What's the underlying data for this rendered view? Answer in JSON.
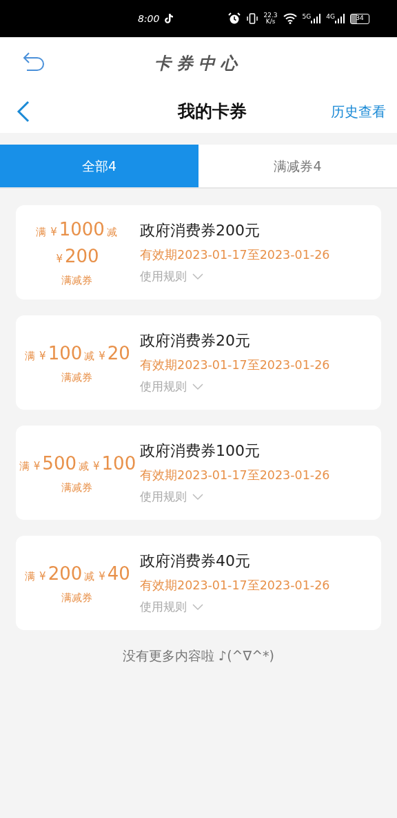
{
  "status_bar": {
    "time": "8:00",
    "speed": "22.3",
    "speed_unit": "K/s",
    "network_1": "5G",
    "network_2": "4G",
    "battery": "34"
  },
  "app_header": {
    "title": "卡券中心"
  },
  "nav": {
    "title": "我的卡券",
    "action": "历史查看"
  },
  "tabs": [
    {
      "label": "全部4",
      "selected": true
    },
    {
      "label": "满减券4",
      "selected": false
    }
  ],
  "coupons": [
    {
      "min_prefix": "满",
      "currency_1": "¥",
      "min_amount": "1000",
      "cut_prefix": "减",
      "currency_2": "¥",
      "cut_amount": "200",
      "type_label": "满减券",
      "name": "政府消费券200元",
      "validity": "有效期2023-01-17至2023-01-26",
      "rules": "使用规则",
      "expanded": false
    },
    {
      "min_prefix": "满",
      "currency_1": "¥",
      "min_amount": "100",
      "cut_prefix": "减",
      "currency_2": "¥",
      "cut_amount": "20",
      "type_label": "满减券",
      "name": "政府消费券20元",
      "validity": "有效期2023-01-17至2023-01-26",
      "rules": "使用规则",
      "expanded": false
    },
    {
      "min_prefix": "满",
      "currency_1": "¥",
      "min_amount": "500",
      "cut_prefix": "减",
      "currency_2": "¥",
      "cut_amount": "100",
      "type_label": "满减券",
      "name": "政府消费券100元",
      "validity": "有效期2023-01-17至2023-01-26",
      "rules": "使用规则",
      "expanded": false
    },
    {
      "min_prefix": "满",
      "currency_1": "¥",
      "min_amount": "200",
      "cut_prefix": "减",
      "currency_2": "¥",
      "cut_amount": "40",
      "type_label": "满减券",
      "name": "政府消费券40元",
      "validity": "有效期2023-01-17至2023-01-26",
      "rules": "使用规则",
      "expanded": false
    }
  ],
  "footer_note": "没有更多内容啦 ♪(^∇^*)"
}
